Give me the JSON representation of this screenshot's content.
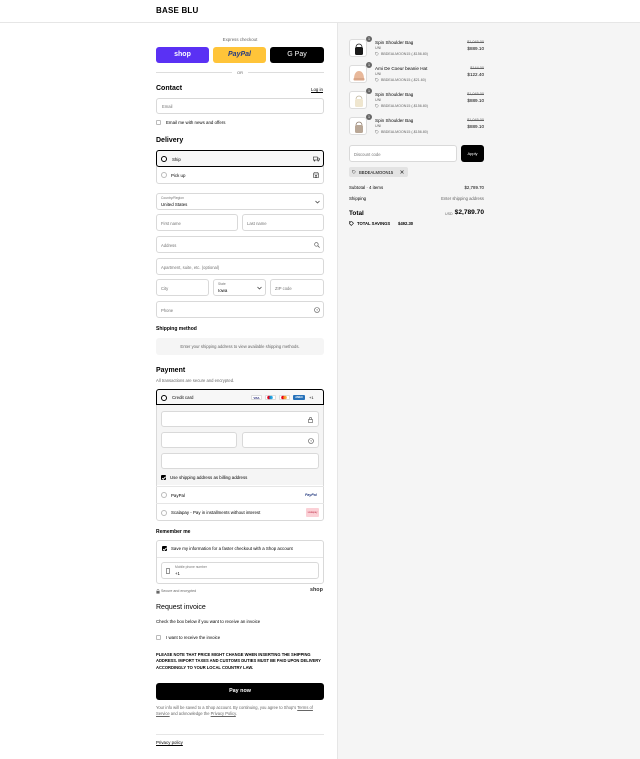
{
  "brand": "BASE BLU",
  "express": {
    "title": "Express checkout",
    "shop": "shop",
    "paypal": "PayPal",
    "gpay": "G Pay",
    "or": "OR"
  },
  "contact": {
    "title": "Contact",
    "login": "Log in",
    "email_placeholder": "Email",
    "newsletter": "Email me with news and offers"
  },
  "delivery": {
    "title": "Delivery",
    "ship": "Ship",
    "pickup": "Pick up",
    "country_label": "Country/Region",
    "country_value": "United States",
    "first_name": "First name",
    "last_name": "Last name",
    "address": "Address",
    "apartment": "Apartment, suite, etc. (optional)",
    "city": "City",
    "state_label": "State",
    "state_value": "Iowa",
    "zip": "ZIP code",
    "phone": "Phone"
  },
  "shipping_method": {
    "title": "Shipping method",
    "note": "Enter your shipping address to view available shipping methods."
  },
  "payment": {
    "title": "Payment",
    "subtitle": "All transactions are secure and encrypted.",
    "credit_card": "Credit card",
    "cards": [
      "VISA",
      "MC",
      "MC",
      "AMEX"
    ],
    "more_cards": "+1",
    "billing_same": "Use shipping address as billing address",
    "paypal": "PayPal",
    "paypal_logo": "PayPal",
    "scalapay": "Scalapay - Pay in installments without interest",
    "scalapay_logo": "scalapay"
  },
  "remember": {
    "title": "Remember me",
    "save_info": "Save my information for a faster checkout with a Shop account",
    "phone_label": "Mobile phone number",
    "phone_value": "+1",
    "secure": "Secure and encrypted",
    "shop_logo": "shop"
  },
  "invoice": {
    "title": "Request invoice",
    "subtitle": "Check the box below if you want to receive an invoice",
    "checkbox": "I want to receive the invoice",
    "notice": "PLEASE NOTE THAT PRICE MIGHT CHANGE WHEN INSERTING THE SHIPPING ADDRESS. IMPORT TAXES AND CUSTOMS DUTIES MUST BE PAID UPON DELIVERY ACCORDINGLY TO YOUR LOCAL COUNTRY LAW."
  },
  "pay_now": "Pay now",
  "legal": {
    "line1": "Your info will be saved to a Shop account. By continuing, you agree to Shop's",
    "terms": "Terms of Service",
    "and": "and acknowledge the",
    "privacy": "Privacy Policy",
    "period": "."
  },
  "privacy_policy": "Privacy policy",
  "cart": {
    "items": [
      {
        "name": "Spin Shoulder Bag",
        "variant": "UNI",
        "discount": "BBDEALMOON15 (-$156.80)",
        "old_price": "$1,045.00",
        "price": "$889.10",
        "qty": "1"
      },
      {
        "name": "Ami De Coeur beanie Hat",
        "variant": "UNI",
        "discount": "BBDEALMOON15 (-$21.60)",
        "old_price": "$144.00",
        "price": "$122.40",
        "qty": "1"
      },
      {
        "name": "Spin Shoulder Bag",
        "variant": "UNI",
        "discount": "BBDEALMOON15 (-$156.80)",
        "old_price": "$1,045.00",
        "price": "$889.10",
        "qty": "1"
      },
      {
        "name": "Spin Shoulder Bag",
        "variant": "UNI",
        "discount": "BBDEALMOON15 (-$156.80)",
        "old_price": "$1,045.00",
        "price": "$889.10",
        "qty": "1"
      }
    ],
    "discount_placeholder": "Discount code",
    "apply": "Apply",
    "code_tag": "BBDEALMOON15",
    "subtotal_label": "Subtotal · 4 items",
    "subtotal_value": "$2,789.70",
    "shipping_label": "Shipping",
    "shipping_value": "Enter shipping address",
    "total_label": "Total",
    "currency": "USD",
    "total_value": "$2,789.70",
    "savings_label": "TOTAL SAVINGS",
    "savings_value": "$492.30"
  }
}
